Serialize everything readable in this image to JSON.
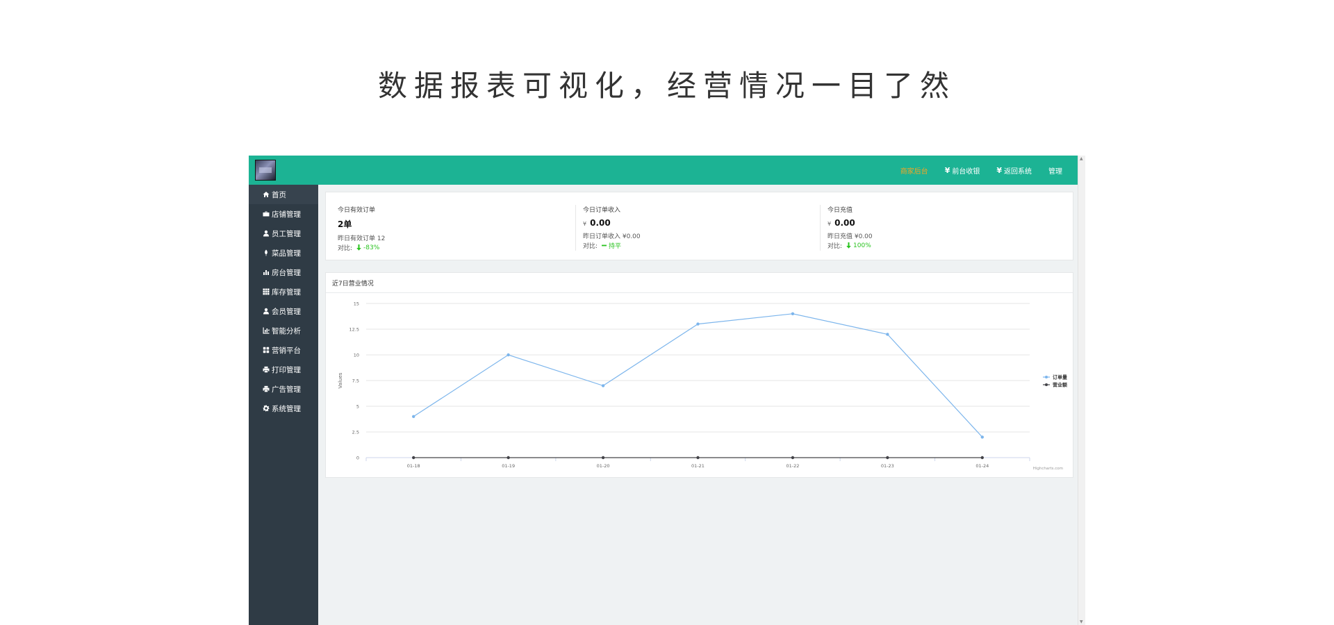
{
  "hero": {
    "title": "数据报表可视化，经营情况一目了然"
  },
  "topbar": {
    "nav": [
      {
        "label": "商家后台",
        "icon": ""
      },
      {
        "label": "前台收银",
        "icon": "¥"
      },
      {
        "label": "返回系统",
        "icon": "¥"
      },
      {
        "label": "管理",
        "icon": ""
      }
    ]
  },
  "sidebar": {
    "items": [
      {
        "label": "首页",
        "icon": "home-icon"
      },
      {
        "label": "店铺管理",
        "icon": "briefcase-icon"
      },
      {
        "label": "员工管理",
        "icon": "user-icon"
      },
      {
        "label": "菜品管理",
        "icon": "leaf-icon"
      },
      {
        "label": "房台管理",
        "icon": "bar-chart-icon"
      },
      {
        "label": "库存管理",
        "icon": "grid-icon"
      },
      {
        "label": "会员管理",
        "icon": "user-icon"
      },
      {
        "label": "智能分析",
        "icon": "analysis-icon"
      },
      {
        "label": "营销平台",
        "icon": "apps-icon"
      },
      {
        "label": "打印管理",
        "icon": "printer-icon"
      },
      {
        "label": "广告管理",
        "icon": "printer-icon"
      },
      {
        "label": "系统管理",
        "icon": "gear-icon"
      }
    ]
  },
  "stats": {
    "orders": {
      "label": "今日有效订单",
      "value": "2单",
      "prev": "昨日有效订单 12",
      "cmp_label": "对比:",
      "cmp_value": "-83%",
      "cmp_icon": "arrow-down-icon"
    },
    "income": {
      "label": "今日订单收入",
      "currency": "¥",
      "value": "0.00",
      "prev": "昨日订单收入 ¥0.00",
      "cmp_label": "对比:",
      "cmp_value": "持平",
      "cmp_icon": "minus-icon"
    },
    "recharge": {
      "label": "今日充值",
      "currency": "¥",
      "value": "0.00",
      "prev": "昨日充值 ¥0.00",
      "cmp_label": "对比:",
      "cmp_value": "100%",
      "cmp_icon": "arrow-down-icon"
    }
  },
  "colors": {
    "brand": "#1cb394",
    "sidebar": "#2f3b45",
    "positive": "#28c31e",
    "highlight": "#f5a623",
    "series_orders": "#7cb5ec",
    "series_revenue": "#434348"
  },
  "chart": {
    "title": "近7日营业情况",
    "credits": "Highcharts.com"
  },
  "chart_data": {
    "type": "line",
    "title": "近7日营业情况",
    "xlabel": "",
    "ylabel": "Values",
    "categories": [
      "01-18",
      "01-19",
      "01-20",
      "01-21",
      "01-22",
      "01-23",
      "01-24"
    ],
    "yticks": [
      "0",
      "2.5",
      "5",
      "7.5",
      "10",
      "12.5",
      "15"
    ],
    "ylim": [
      0,
      15
    ],
    "grid": true,
    "legend": "right",
    "series": [
      {
        "name": "订单量",
        "color": "#7cb5ec",
        "values": [
          4,
          10,
          7,
          13,
          14,
          12,
          2
        ]
      },
      {
        "name": "营业额",
        "color": "#434348",
        "values": [
          0,
          0,
          0,
          0,
          0,
          0,
          0
        ]
      }
    ]
  }
}
